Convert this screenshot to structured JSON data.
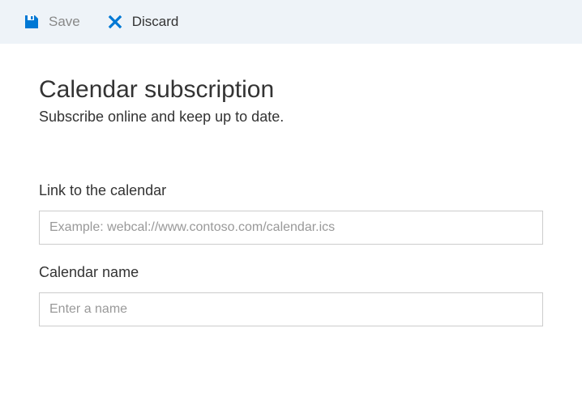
{
  "toolbar": {
    "save_label": "Save",
    "discard_label": "Discard"
  },
  "page": {
    "title": "Calendar subscription",
    "subtitle": "Subscribe online and keep up to date."
  },
  "fields": {
    "link": {
      "label": "Link to the calendar",
      "placeholder": "Example: webcal://www.contoso.com/calendar.ics",
      "value": ""
    },
    "name": {
      "label": "Calendar name",
      "placeholder": "Enter a name",
      "value": ""
    }
  },
  "colors": {
    "accent": "#0078d4",
    "toolbar_bg": "#eef3f8"
  }
}
